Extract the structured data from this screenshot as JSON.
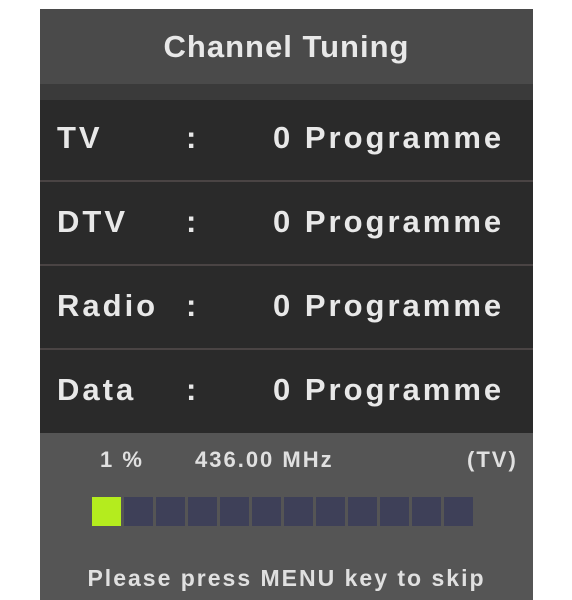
{
  "window": {
    "title": "Channel Tuning"
  },
  "channels": [
    {
      "name": "TV",
      "colon": ":",
      "value": "0 Programme"
    },
    {
      "name": "DTV",
      "colon": ":",
      "value": "0 Programme"
    },
    {
      "name": "Radio",
      "colon": ":",
      "value": "0 Programme"
    },
    {
      "name": "Data",
      "colon": ":",
      "value": "0 Programme"
    }
  ],
  "scan": {
    "percent_label": "1 %",
    "frequency": "436.00 MHz",
    "mode": "(TV)",
    "progress": {
      "total_segments": 12,
      "filled_segments": 1,
      "fill_color": "#b4ec1e",
      "empty_color": "#3e4058"
    }
  },
  "hint": "Please press MENU key to skip",
  "colors": {
    "title_bg": "#4a4a4a",
    "list_bg": "#2a2a2a",
    "panel_bg": "#555555",
    "text": "#e8e8e8"
  }
}
